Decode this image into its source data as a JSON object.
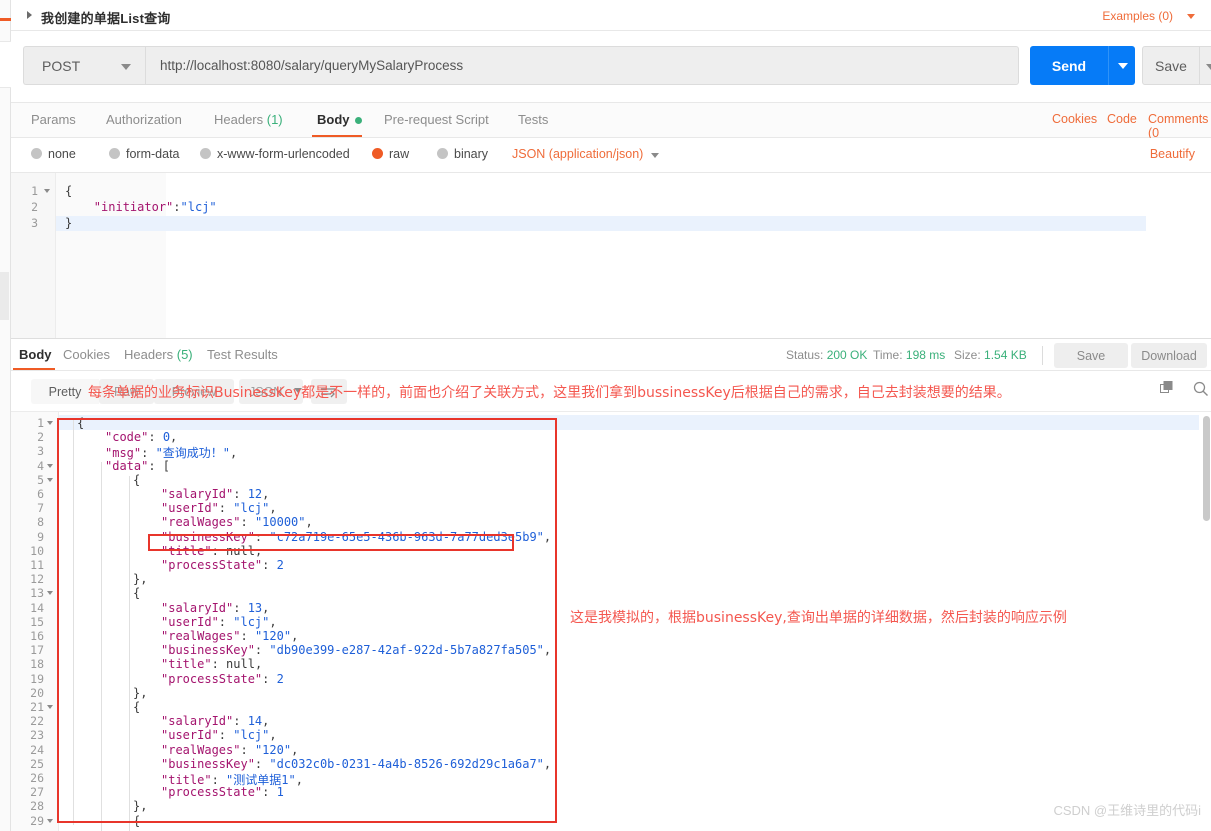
{
  "request": {
    "title": "我创建的单据List查询",
    "examples_label": "Examples (0)",
    "method": "POST",
    "url": "http://localhost:8080/salary/queryMySalaryProcess",
    "send_label": "Send",
    "save_label": "Save",
    "tabs": [
      {
        "label": "Params",
        "active": false
      },
      {
        "label": "Authorization",
        "active": false
      },
      {
        "label": "Headers",
        "count": "(1)",
        "active": false
      },
      {
        "label": "Body",
        "active": true,
        "dot": true
      },
      {
        "label": "Pre-request Script",
        "active": false
      },
      {
        "label": "Tests",
        "active": false
      }
    ],
    "header_links": [
      "Cookies",
      "Code",
      "Comments (0"
    ],
    "body_types": [
      {
        "label": "none",
        "selected": false
      },
      {
        "label": "form-data",
        "selected": false
      },
      {
        "label": "x-www-form-urlencoded",
        "selected": false
      },
      {
        "label": "raw",
        "selected": true
      },
      {
        "label": "binary",
        "selected": false
      }
    ],
    "content_type": "JSON (application/json)",
    "beautify_label": "Beautify",
    "editor_lines": [
      {
        "no": "1",
        "fold": true,
        "tokens": [
          {
            "t": "{",
            "c": "p"
          }
        ]
      },
      {
        "no": "2",
        "fold": false,
        "indent": 4,
        "tokens": [
          {
            "t": "\"initiator\"",
            "c": "k"
          },
          {
            "t": ":",
            "c": "p"
          },
          {
            "t": "\"lcj\"",
            "c": "s"
          }
        ]
      },
      {
        "no": "3",
        "fold": false,
        "tokens": [
          {
            "t": "}",
            "c": "p"
          }
        ]
      }
    ]
  },
  "response": {
    "tabs": [
      {
        "label": "Body",
        "active": true
      },
      {
        "label": "Cookies",
        "active": false
      },
      {
        "label": "Headers",
        "count": "(5)",
        "active": false
      },
      {
        "label": "Test Results",
        "active": false
      }
    ],
    "status_label": "Status:",
    "status_value": "200 OK",
    "time_label": "Time:",
    "time_value": "198 ms",
    "size_label": "Size:",
    "size_value": "1.54 KB",
    "save_label": "Save",
    "download_label": "Download",
    "view_modes": [
      {
        "label": "Pretty",
        "active": true
      },
      {
        "label": "Raw",
        "active": false
      },
      {
        "label": "Preview",
        "active": false
      }
    ],
    "format_label": "JSON",
    "copy_icon": "copy-icon",
    "search_icon": "search-icon",
    "code_lines": [
      {
        "no": "1",
        "fold": true,
        "indent": 0,
        "tokens": [
          {
            "t": "{",
            "c": "p"
          }
        ]
      },
      {
        "no": "2",
        "fold": false,
        "indent": 1,
        "tokens": [
          {
            "t": "\"code\"",
            "c": "k"
          },
          {
            "t": ": ",
            "c": "p"
          },
          {
            "t": "0",
            "c": "n"
          },
          {
            "t": ",",
            "c": "p"
          }
        ]
      },
      {
        "no": "3",
        "fold": false,
        "indent": 1,
        "tokens": [
          {
            "t": "\"msg\"",
            "c": "k"
          },
          {
            "t": ": ",
            "c": "p"
          },
          {
            "t": "\"查询成功！\"",
            "c": "s"
          },
          {
            "t": ",",
            "c": "p"
          }
        ]
      },
      {
        "no": "4",
        "fold": true,
        "indent": 1,
        "tokens": [
          {
            "t": "\"data\"",
            "c": "k"
          },
          {
            "t": ": [",
            "c": "p"
          }
        ]
      },
      {
        "no": "5",
        "fold": true,
        "indent": 2,
        "tokens": [
          {
            "t": "{",
            "c": "p"
          }
        ]
      },
      {
        "no": "6",
        "fold": false,
        "indent": 3,
        "tokens": [
          {
            "t": "\"salaryId\"",
            "c": "k"
          },
          {
            "t": ": ",
            "c": "p"
          },
          {
            "t": "12",
            "c": "n"
          },
          {
            "t": ",",
            "c": "p"
          }
        ]
      },
      {
        "no": "7",
        "fold": false,
        "indent": 3,
        "tokens": [
          {
            "t": "\"userId\"",
            "c": "k"
          },
          {
            "t": ": ",
            "c": "p"
          },
          {
            "t": "\"lcj\"",
            "c": "s"
          },
          {
            "t": ",",
            "c": "p"
          }
        ]
      },
      {
        "no": "8",
        "fold": false,
        "indent": 3,
        "tokens": [
          {
            "t": "\"realWages\"",
            "c": "k"
          },
          {
            "t": ": ",
            "c": "p"
          },
          {
            "t": "\"10000\"",
            "c": "s"
          },
          {
            "t": ",",
            "c": "p"
          }
        ]
      },
      {
        "no": "9",
        "fold": false,
        "indent": 3,
        "tokens": [
          {
            "t": "\"businessKey\"",
            "c": "k"
          },
          {
            "t": ": ",
            "c": "p"
          },
          {
            "t": "\"c72a719e-65e5-436b-963d-7a77ded3e5b9\"",
            "c": "s"
          },
          {
            "t": ",",
            "c": "p"
          }
        ]
      },
      {
        "no": "10",
        "fold": false,
        "indent": 3,
        "tokens": [
          {
            "t": "\"title\"",
            "c": "k"
          },
          {
            "t": ": ",
            "c": "p"
          },
          {
            "t": "null",
            "c": "nul"
          },
          {
            "t": ",",
            "c": "p"
          }
        ]
      },
      {
        "no": "11",
        "fold": false,
        "indent": 3,
        "tokens": [
          {
            "t": "\"processState\"",
            "c": "k"
          },
          {
            "t": ": ",
            "c": "p"
          },
          {
            "t": "2",
            "c": "n"
          }
        ]
      },
      {
        "no": "12",
        "fold": false,
        "indent": 2,
        "tokens": [
          {
            "t": "},",
            "c": "p"
          }
        ]
      },
      {
        "no": "13",
        "fold": true,
        "indent": 2,
        "tokens": [
          {
            "t": "{",
            "c": "p"
          }
        ]
      },
      {
        "no": "14",
        "fold": false,
        "indent": 3,
        "tokens": [
          {
            "t": "\"salaryId\"",
            "c": "k"
          },
          {
            "t": ": ",
            "c": "p"
          },
          {
            "t": "13",
            "c": "n"
          },
          {
            "t": ",",
            "c": "p"
          }
        ]
      },
      {
        "no": "15",
        "fold": false,
        "indent": 3,
        "tokens": [
          {
            "t": "\"userId\"",
            "c": "k"
          },
          {
            "t": ": ",
            "c": "p"
          },
          {
            "t": "\"lcj\"",
            "c": "s"
          },
          {
            "t": ",",
            "c": "p"
          }
        ]
      },
      {
        "no": "16",
        "fold": false,
        "indent": 3,
        "tokens": [
          {
            "t": "\"realWages\"",
            "c": "k"
          },
          {
            "t": ": ",
            "c": "p"
          },
          {
            "t": "\"120\"",
            "c": "s"
          },
          {
            "t": ",",
            "c": "p"
          }
        ]
      },
      {
        "no": "17",
        "fold": false,
        "indent": 3,
        "tokens": [
          {
            "t": "\"businessKey\"",
            "c": "k"
          },
          {
            "t": ": ",
            "c": "p"
          },
          {
            "t": "\"db90e399-e287-42af-922d-5b7a827fa505\"",
            "c": "s"
          },
          {
            "t": ",",
            "c": "p"
          }
        ]
      },
      {
        "no": "18",
        "fold": false,
        "indent": 3,
        "tokens": [
          {
            "t": "\"title\"",
            "c": "k"
          },
          {
            "t": ": ",
            "c": "p"
          },
          {
            "t": "null",
            "c": "nul"
          },
          {
            "t": ",",
            "c": "p"
          }
        ]
      },
      {
        "no": "19",
        "fold": false,
        "indent": 3,
        "tokens": [
          {
            "t": "\"processState\"",
            "c": "k"
          },
          {
            "t": ": ",
            "c": "p"
          },
          {
            "t": "2",
            "c": "n"
          }
        ]
      },
      {
        "no": "20",
        "fold": false,
        "indent": 2,
        "tokens": [
          {
            "t": "},",
            "c": "p"
          }
        ]
      },
      {
        "no": "21",
        "fold": true,
        "indent": 2,
        "tokens": [
          {
            "t": "{",
            "c": "p"
          }
        ]
      },
      {
        "no": "22",
        "fold": false,
        "indent": 3,
        "tokens": [
          {
            "t": "\"salaryId\"",
            "c": "k"
          },
          {
            "t": ": ",
            "c": "p"
          },
          {
            "t": "14",
            "c": "n"
          },
          {
            "t": ",",
            "c": "p"
          }
        ]
      },
      {
        "no": "23",
        "fold": false,
        "indent": 3,
        "tokens": [
          {
            "t": "\"userId\"",
            "c": "k"
          },
          {
            "t": ": ",
            "c": "p"
          },
          {
            "t": "\"lcj\"",
            "c": "s"
          },
          {
            "t": ",",
            "c": "p"
          }
        ]
      },
      {
        "no": "24",
        "fold": false,
        "indent": 3,
        "tokens": [
          {
            "t": "\"realWages\"",
            "c": "k"
          },
          {
            "t": ": ",
            "c": "p"
          },
          {
            "t": "\"120\"",
            "c": "s"
          },
          {
            "t": ",",
            "c": "p"
          }
        ]
      },
      {
        "no": "25",
        "fold": false,
        "indent": 3,
        "tokens": [
          {
            "t": "\"businessKey\"",
            "c": "k"
          },
          {
            "t": ": ",
            "c": "p"
          },
          {
            "t": "\"dc032c0b-0231-4a4b-8526-692d29c1a6a7\"",
            "c": "s"
          },
          {
            "t": ",",
            "c": "p"
          }
        ]
      },
      {
        "no": "26",
        "fold": false,
        "indent": 3,
        "tokens": [
          {
            "t": "\"title\"",
            "c": "k"
          },
          {
            "t": ": ",
            "c": "p"
          },
          {
            "t": "\"测试单据1\"",
            "c": "s"
          },
          {
            "t": ",",
            "c": "p"
          }
        ]
      },
      {
        "no": "27",
        "fold": false,
        "indent": 3,
        "tokens": [
          {
            "t": "\"processState\"",
            "c": "k"
          },
          {
            "t": ": ",
            "c": "p"
          },
          {
            "t": "1",
            "c": "n"
          }
        ]
      },
      {
        "no": "28",
        "fold": false,
        "indent": 2,
        "tokens": [
          {
            "t": "},",
            "c": "p"
          }
        ]
      },
      {
        "no": "29",
        "fold": true,
        "indent": 2,
        "tokens": [
          {
            "t": "{",
            "c": "p"
          }
        ]
      }
    ]
  },
  "annotations": {
    "top_note": "每条单据的业务标识BusinessKey都是不一样的，前面也介绍了关联方式，这里我们拿到bussinessKey后根据自己的需求，自己去封装想要的结果。",
    "right_note": "这是我模拟的，根据businessKey,查询出单据的详细数据，然后封装的响应示例"
  },
  "watermark": "CSDN @王维诗里的代码i",
  "colors": {
    "accent": "#ef5b25",
    "send_blue": "#067bf7",
    "status_green": "#3ab07a",
    "annotation_red": "#f4574f",
    "highlight_box": "#e8352b"
  }
}
